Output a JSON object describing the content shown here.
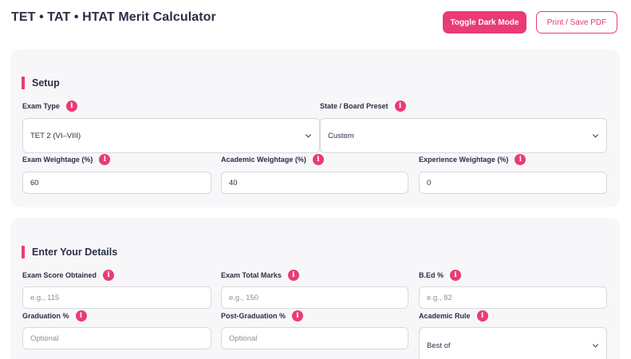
{
  "header": {
    "title": "TET • TAT • HTAT Merit Calculator",
    "dark_mode_label": "Toggle Dark Mode",
    "print_label": "Print / Save PDF"
  },
  "setup": {
    "title": "Setup",
    "exam_type": {
      "label": "Exam Type",
      "value": "TET 2 (VI–VIII)"
    },
    "board_preset": {
      "label": "State / Board Preset",
      "value": "Custom"
    },
    "exam_weightage": {
      "label": "Exam Weightage (%)",
      "value": "60"
    },
    "academic_weightage": {
      "label": "Academic Weightage (%)",
      "value": "40"
    },
    "experience_weightage": {
      "label": "Experience Weightage (%)",
      "value": "0"
    }
  },
  "details": {
    "title": "Enter Your Details",
    "exam_score": {
      "label": "Exam Score Obtained",
      "placeholder": "e.g., 115"
    },
    "exam_total": {
      "label": "Exam Total Marks",
      "placeholder": "e.g., 150"
    },
    "bed": {
      "label": "B.Ed %",
      "placeholder": "e.g., 82"
    },
    "graduation": {
      "label": "Graduation %",
      "placeholder": "Optional"
    },
    "post_graduation": {
      "label": "Post-Graduation %",
      "placeholder": "Optional"
    },
    "academic_rule": {
      "label": "Academic Rule",
      "value": "Best of"
    }
  },
  "icons": {
    "info": "i"
  },
  "colors": {
    "accent": "#ea3b75",
    "card": "#f7f7f9",
    "text": "#2a2f45"
  }
}
